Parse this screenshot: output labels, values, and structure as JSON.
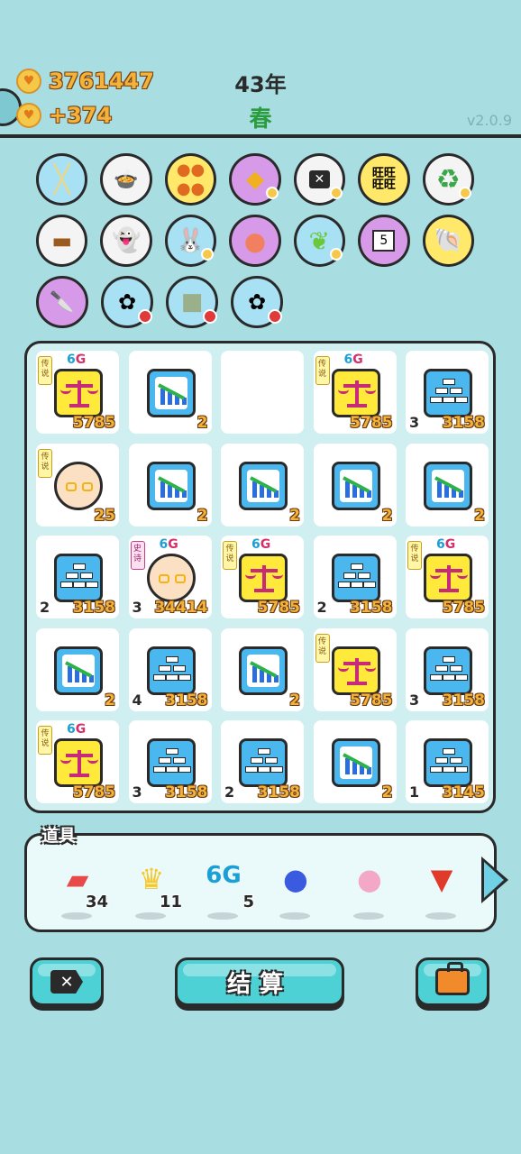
{
  "header": {
    "coins": "3761447",
    "income": "+374",
    "year": "43年",
    "season": "春",
    "version": "v2.0.9"
  },
  "items": [
    [
      "chopsticks-icon",
      "rice-cooker-icon",
      "basketballs-icon",
      "leaf-coin-icon",
      "delete-ticket-icon",
      "wang-pattern-icon",
      "recycle-icon"
    ],
    [
      "dog-bowl-icon",
      "ghost-icon",
      "rabbit-icon",
      "grapefruit-icon",
      "green-leaf-coin-icon",
      "calendar-icon",
      "shell-icon"
    ],
    [
      "cleaver-icon",
      "flower-pot-icon",
      "seed-bag-icon",
      "flower-pot-icon"
    ]
  ],
  "board": {
    "rows": [
      [
        {
          "type": "scale",
          "value": "5785",
          "count": "",
          "tag": "6G",
          "legend": "传说"
        },
        {
          "type": "chart",
          "value": "2",
          "count": "",
          "tag": "",
          "legend": ""
        },
        {
          "type": "empty",
          "value": "",
          "count": "",
          "tag": "",
          "legend": ""
        },
        {
          "type": "scale",
          "value": "5785",
          "count": "",
          "tag": "6G",
          "legend": "传说"
        },
        {
          "type": "gold",
          "value": "3158",
          "count": "3",
          "tag": "",
          "legend": ""
        }
      ],
      [
        {
          "type": "face",
          "value": "25",
          "count": "",
          "tag": "",
          "legend": "传说"
        },
        {
          "type": "chart",
          "value": "2",
          "count": "",
          "tag": "",
          "legend": ""
        },
        {
          "type": "chart",
          "value": "2",
          "count": "",
          "tag": "",
          "legend": ""
        },
        {
          "type": "chart",
          "value": "2",
          "count": "",
          "tag": "",
          "legend": ""
        },
        {
          "type": "chart",
          "value": "2",
          "count": "",
          "tag": "",
          "legend": ""
        }
      ],
      [
        {
          "type": "gold",
          "value": "3158",
          "count": "2",
          "tag": "",
          "legend": ""
        },
        {
          "type": "face",
          "value": "34414",
          "count": "3",
          "tag": "6G",
          "legend": "史诗"
        },
        {
          "type": "scale",
          "value": "5785",
          "count": "",
          "tag": "6G",
          "legend": "传说"
        },
        {
          "type": "gold",
          "value": "3158",
          "count": "2",
          "tag": "",
          "legend": ""
        },
        {
          "type": "scale",
          "value": "5785",
          "count": "",
          "tag": "6G",
          "legend": "传说"
        }
      ],
      [
        {
          "type": "chart",
          "value": "2",
          "count": "",
          "tag": "",
          "legend": ""
        },
        {
          "type": "gold",
          "value": "3158",
          "count": "4",
          "tag": "",
          "legend": ""
        },
        {
          "type": "chart",
          "value": "2",
          "count": "",
          "tag": "",
          "legend": ""
        },
        {
          "type": "scale",
          "value": "5785",
          "count": "",
          "tag": "",
          "legend": "传说"
        },
        {
          "type": "gold",
          "value": "3158",
          "count": "3",
          "tag": "",
          "legend": ""
        }
      ],
      [
        {
          "type": "scale",
          "value": "5785",
          "count": "",
          "tag": "6G",
          "legend": "传说"
        },
        {
          "type": "gold",
          "value": "3158",
          "count": "3",
          "tag": "",
          "legend": ""
        },
        {
          "type": "gold",
          "value": "3158",
          "count": "2",
          "tag": "",
          "legend": ""
        },
        {
          "type": "chart",
          "value": "2",
          "count": "",
          "tag": "",
          "legend": ""
        },
        {
          "type": "gold",
          "value": "3145",
          "count": "1",
          "tag": "",
          "legend": ""
        }
      ]
    ]
  },
  "props": {
    "title": "道具",
    "items": [
      {
        "name": "liver-icon",
        "count": "34"
      },
      {
        "name": "crown-icon",
        "count": "11"
      },
      {
        "name": "6g-icon",
        "count": "5",
        "label": "6G"
      },
      {
        "name": "blueberry-icon",
        "count": ""
      },
      {
        "name": "piggy-bank-icon",
        "count": ""
      },
      {
        "name": "strawberry-icon",
        "count": ""
      }
    ]
  },
  "buttons": {
    "settle": "结算"
  },
  "colors": {
    "background": "#a8dde2",
    "coin_text": "#f3b33a",
    "season_green": "#2a9c3e",
    "button_cyan": "#4ed1d4"
  }
}
